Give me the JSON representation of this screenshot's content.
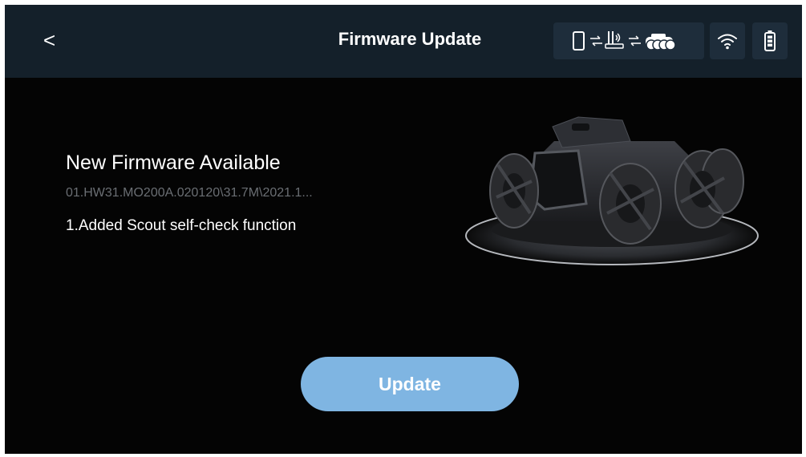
{
  "header": {
    "back_label": "<",
    "title": "Firmware Update"
  },
  "status_icons": [
    "phone-icon",
    "link-arrow-icon",
    "router-icon",
    "link-arrow-icon",
    "robot-icon",
    "wifi-icon",
    "battery-icon"
  ],
  "firmware": {
    "heading": "New Firmware Available",
    "version": "01.HW31.MO200A.020120\\31.7M\\2021.1...",
    "notes": "1.Added Scout self-check function"
  },
  "actions": {
    "update_label": "Update"
  },
  "colors": {
    "background": "#040404",
    "header": "#14202a",
    "icon_pill": "#1e2d3b",
    "button": "#7fb5e2",
    "secondary_text": "#6a6e73"
  }
}
